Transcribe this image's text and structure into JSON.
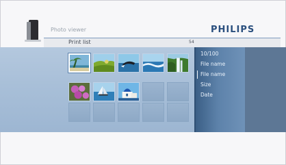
{
  "header": {
    "app_title": "Photo viewer",
    "brand": "PHILIPS"
  },
  "subheader": {
    "list_title": "Print list",
    "count": "54"
  },
  "info_panel": {
    "index": "10/100",
    "file_name_1": "File name",
    "file_name_2": "File name",
    "size_label": "Size",
    "date_label": "Date"
  },
  "colors": {
    "brand": "#2a4f7e",
    "band": "#a8bfd8",
    "panel": "#4a6d96"
  },
  "thumbnails": [
    {
      "name": "thumb-palm-beach",
      "state": "selected"
    },
    {
      "name": "thumb-green-field",
      "state": "photo"
    },
    {
      "name": "thumb-whale-jump",
      "state": "photo"
    },
    {
      "name": "thumb-ocean-wave",
      "state": "photo"
    },
    {
      "name": "thumb-waterfall",
      "state": "photo"
    },
    {
      "name": "thumb-pink-flowers",
      "state": "photo"
    },
    {
      "name": "thumb-sailing-boat",
      "state": "photo"
    },
    {
      "name": "thumb-white-village",
      "state": "photo"
    }
  ]
}
